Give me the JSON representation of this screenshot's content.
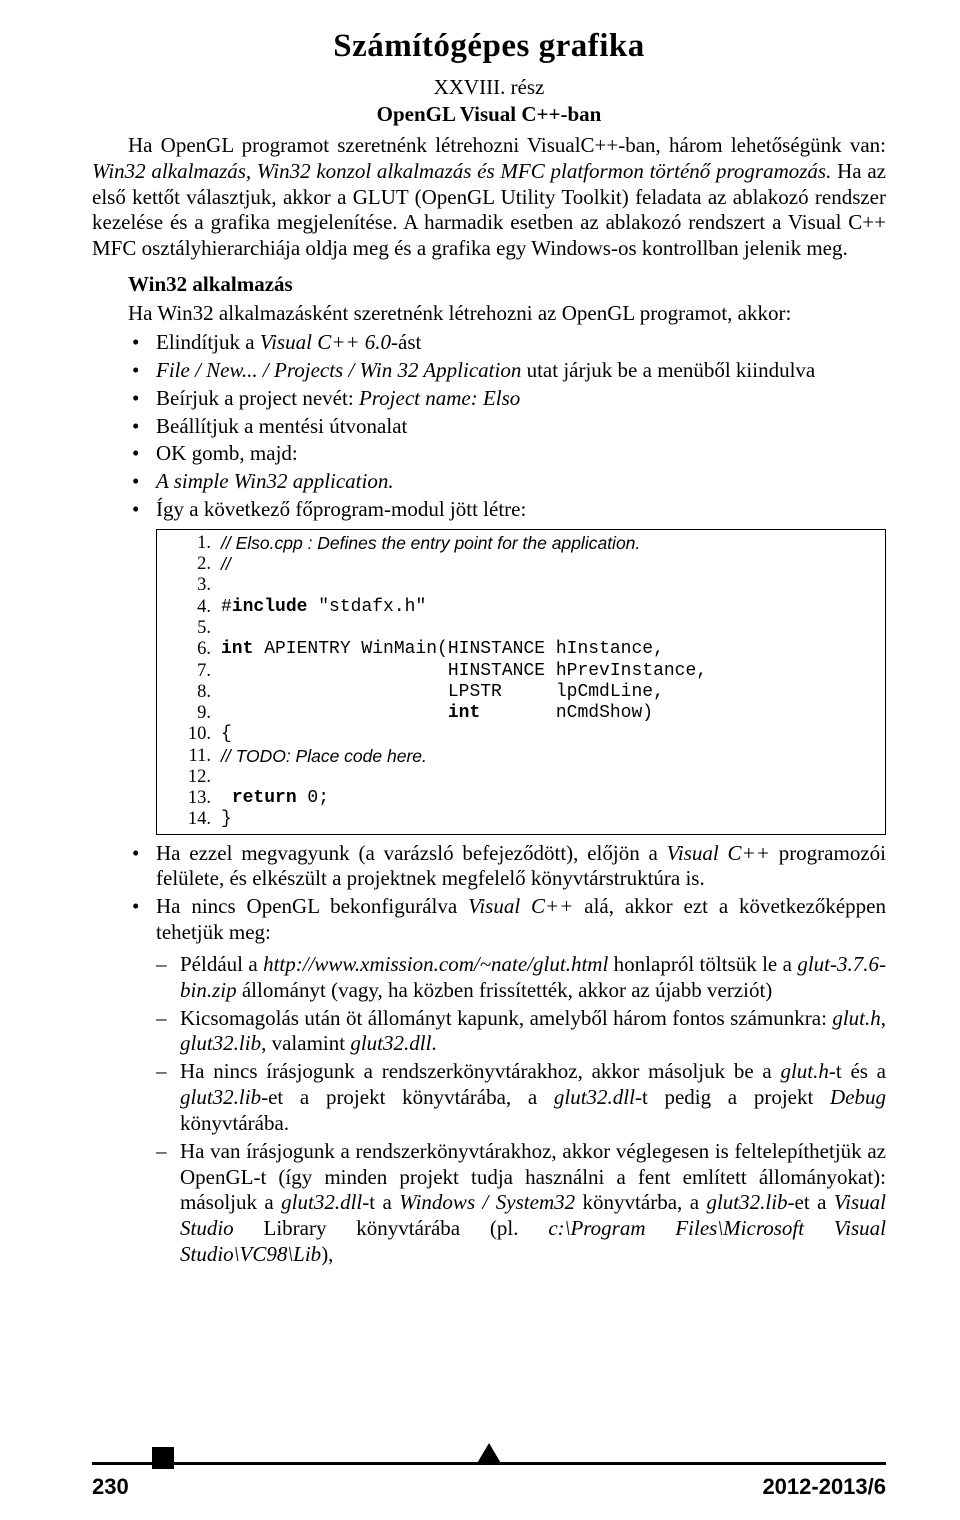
{
  "title": "Számítógépes grafika",
  "part": "XXVIII. rész",
  "subtitle": "OpenGL Visual C++-ban",
  "intro_html": "Ha OpenGL programot szeretnénk létrehozni VisualC++-ban, három lehetőségünk van: <i>Win32 alkalmazás, Win32 konzol alkalmazás és MFC platformon történő programozás.</i> Ha az első kettőt választjuk, akkor a GLUT (OpenGL Utility Toolkit) feladata az ablakozó rendszer kezelése és a grafika megjelenítése. A harmadik esetben az ablakozó rendszert a Visual C++ MFC osztályhierarchiája oldja meg és a grafika egy Windows-os kontrollban jelenik meg.",
  "section_head": "Win32 alkalmazás",
  "section_lead": "Ha Win32 alkalmazásként szeretnénk létrehozni az OpenGL programot, akkor:",
  "bullets1": [
    "Elindítjuk a <i>Visual C++ 6.0</i>-ást",
    "<i>File / New... / Projects / Win 32 Application</i> utat járjuk be a menüből kiindulva",
    "Beírjuk a project nevét: <i>Project name: Elso</i>",
    "Beállítjuk a mentési útvonalat",
    "OK gomb, majd:",
    "<i>A simple Win32 application.</i>",
    "Így a következő főprogram-modul jött létre:"
  ],
  "code": [
    {
      "n": "1.",
      "cls": "italic",
      "t": "// Elso.cpp : Defines the entry point for the application."
    },
    {
      "n": "2.",
      "cls": "italic",
      "t": "//"
    },
    {
      "n": "3.",
      "cls": "ct",
      "t": ""
    },
    {
      "n": "4.",
      "cls": "ct",
      "t": "#<b>include</b> \"stdafx.h\""
    },
    {
      "n": "5.",
      "cls": "ct",
      "t": ""
    },
    {
      "n": "6.",
      "cls": "ct",
      "t": "<b>int</b> APIENTRY WinMain(HINSTANCE hInstance,"
    },
    {
      "n": "7.",
      "cls": "ct",
      "t": "                     HINSTANCE hPrevInstance,"
    },
    {
      "n": "8.",
      "cls": "ct",
      "t": "                     LPSTR     lpCmdLine,"
    },
    {
      "n": "9.",
      "cls": "ct",
      "t": "                     <b>int</b>       nCmdShow)"
    },
    {
      "n": "10.",
      "cls": "ct",
      "t": "{"
    },
    {
      "n": "11.",
      "cls": "italic",
      "t": " // TODO: Place code here."
    },
    {
      "n": "12.",
      "cls": "ct",
      "t": ""
    },
    {
      "n": "13.",
      "cls": "ct",
      "t": " <b>return</b> 0;"
    },
    {
      "n": "14.",
      "cls": "ct",
      "t": "}"
    }
  ],
  "bullets2": [
    "Ha ezzel megvagyunk (a varázsló befejeződött), előjön a <i>Visual C++</i> programozói felülete, és elkészült a projektnek megfelelő könyvtárstruktúra is.",
    "Ha nincs OpenGL bekonfigurálva <i>Visual C++</i> alá, akkor ezt a következőképpen tehetjük meg:"
  ],
  "dashes": [
    "Például a <i>http://www.xmission.com/~nate/glut.html</i> honlapról töltsük le a <i>glut-3.7.6-bin.zip</i> állományt (vagy, ha közben frissítették, akkor az újabb verziót)",
    "Kicsomagolás után öt állományt kapunk, amelyből három fontos számunkra: <i>glut.h</i>, <i>glut32.lib</i>, valamint <i>glut32.dll</i>.",
    "Ha nincs írásjogunk a rendszerkönyvtárakhoz, akkor másoljuk be a <i>glut.h</i>-t és a <i>glut32.lib</i>-et a projekt könyvtárába, a <i>glut32.dll</i>-t pedig a projekt <i>Debug</i> könyvtárába.",
    "Ha van írásjogunk a rendszerkönyvtárakhoz, akkor véglegesen is feltelepíthetjük az OpenGL-t (így minden projekt tudja használni a fent említett állományokat): másoljuk a <i>glut32.dll</i>-t a <i>Windows / System32</i> könyvtárba, a <i>glut32.lib</i>-et a <i>Visual Studio</i> Library könyvtárába (pl. <i>c:\\Program Files\\Microsoft Visual Studio\\VC98\\Lib</i>),"
  ],
  "footer": {
    "left": "230",
    "right": "2012-2013/6"
  }
}
